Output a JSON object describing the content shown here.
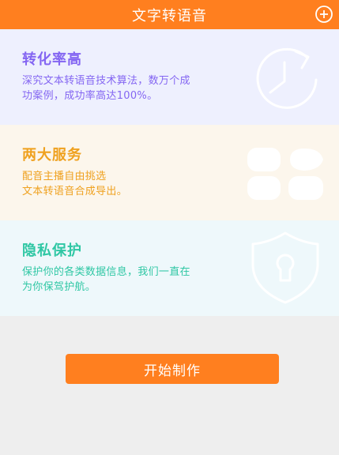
{
  "header": {
    "title": "文字转语音",
    "add_icon": "plus-circle-icon"
  },
  "cards": [
    {
      "title": "转化率高",
      "desc_line1": "深究文本转语音技术算法，数万个成",
      "desc_line2": "功案例，成功率高达100%。",
      "icon": "refresh-clock-icon",
      "color": "#8466f2"
    },
    {
      "title": "两大服务",
      "desc_line1": "配音主播自由挑选",
      "desc_line2": "文本转语音合成导出。",
      "icon": "service-grid-icon",
      "color": "#efa11f"
    },
    {
      "title": "隐私保护",
      "desc_line1": "保护你的各类数据信息，我们一直在",
      "desc_line2": "为你保驾护航。",
      "icon": "shield-lock-icon",
      "color": "#2fc7a4"
    }
  ],
  "start_button": {
    "label": "开始制作"
  },
  "colors": {
    "accent": "#ff7f1f"
  }
}
